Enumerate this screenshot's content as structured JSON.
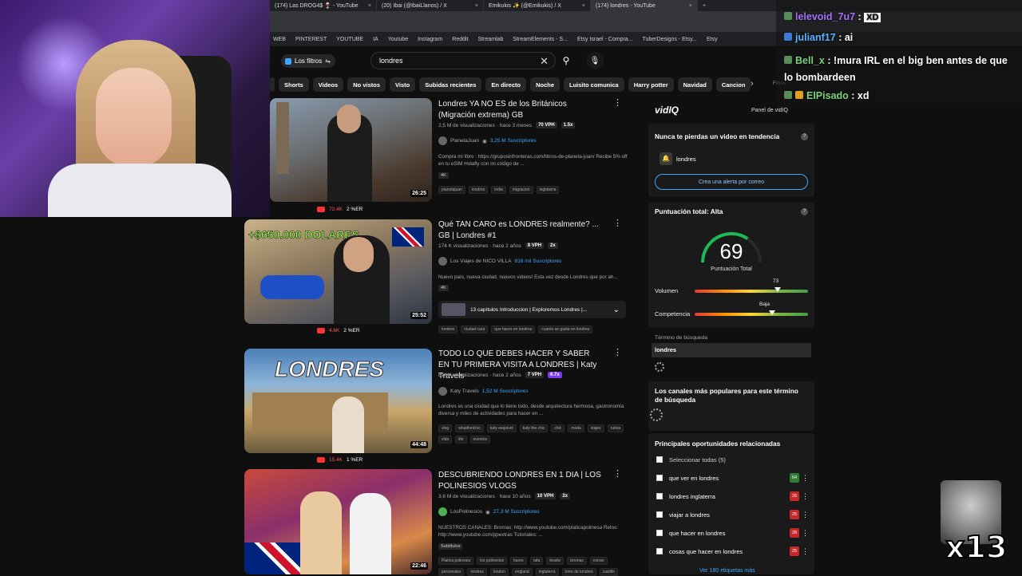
{
  "tabs": [
    {
      "label": "(174) Las DROG4$ 🍷 - YouTube"
    },
    {
      "label": "(20) Ibai (@IbaiLlanos) / X"
    },
    {
      "label": "Emikukis ✨ (@Emikukis) / X"
    },
    {
      "label": "(174) londres - YouTube"
    }
  ],
  "bookmarks": [
    "WEB",
    "PINTEREST",
    "YOUTUBE",
    "IA",
    "Youtube",
    "Instagram",
    "Reddit",
    "Streamlab",
    "StreamElements - S...",
    "Etsy Israel - Compra...",
    "TuberDesigns - Etsy...",
    "Etsy"
  ],
  "youtube": {
    "filters_label": "Los filtros",
    "search_value": "londres",
    "chips": [
      "Shorts",
      "Videos",
      "No vistos",
      "Visto",
      "Subidas recientes",
      "En directo",
      "Noche",
      "Luisito comunica",
      "Harry potter",
      "Navidad",
      "Cancion"
    ],
    "filtros_label": "Filtros"
  },
  "videos": [
    {
      "title": "Londres YA NO ES de los Británicos (Migración extrema) GB",
      "meta": "2,5 M de visualizaciones · hace 3 meses",
      "vph": "70 VPH",
      "mult": "1.5x",
      "channel": "PlanetaJuan",
      "subs": "3,25 M Suscriptores",
      "desc": "Compra mi libro : https://gruposinfronteras.com/libros-de-planeta-juan/ Recibe 5% off en tu eSIM Holafly con mi código de ...",
      "badge": "4K",
      "tags": [
        "planetajuan",
        "londres",
        "india",
        "migracion",
        "inglaterra"
      ],
      "duration": "26:25",
      "views_stat": "72.4K",
      "er": "2 %ER"
    },
    {
      "title": "Qué TAN CARO es LONDRES realmente? ... GB | Londres #1",
      "meta": "174 K visualizaciones · hace 2 años",
      "vph": "8 VPH",
      "mult": "2x",
      "channel": "Los Viajes de NICO VILLA",
      "subs": "816 mil Suscriptores",
      "desc": "Nuevo país, nueva ciudad, nuevos videos! Esta vez desde Londres que por ah...",
      "badge": "4K",
      "chapters": "13 capítulos  Introduccion | Exploremos Londres |...",
      "tags": [
        "londres",
        "ciudad cara",
        "que hacer en londres",
        "cuanto se gasta en londres"
      ],
      "duration": "25:52",
      "views_stat": "4.6K",
      "er": "2 %ER",
      "thumb_text": "+$650.000 DOLARES"
    },
    {
      "title": "TODO LO QUE DEBES HACER Y SABER EN TU PRIMERA VISITA A LONDRES | Katy Travels",
      "meta": "814 K visualizaciones · hace 2 años",
      "vph": "7 VPH",
      "mult": "6.7x",
      "channel": "Katy Travels",
      "subs": "1,52 M Suscriptores",
      "desc": "Londres es una ciudad que lo tiene todo, desde arquitectura hermosa, gastronomía diversa y miles de actividades para hacer en ...",
      "tags": [
        "vlog",
        "whattheichic",
        "katy esquivel",
        "katy the chic",
        "chic",
        "moda",
        "viajes",
        "rutina",
        "vida",
        "life",
        "eventos"
      ],
      "duration": "44:48",
      "views_stat": "15.4K",
      "er": "1 %ER",
      "thumb_text": "LONDRES"
    },
    {
      "title": "DESCUBRIENDO LONDRES EN 1 DIA | LOS POLINESIOS VLOGS",
      "meta": "3,6 M de visualizaciones · hace 10 años",
      "vph": "10 VPH",
      "mult": "2x",
      "channel": "LosPolinesios",
      "subs": "27,3 M Suscriptores",
      "desc": "NUESTROS CANALES: Bromas: http://www.youtube.com/platicapolinesa Retos: http://www.youtube.com/ppextras Tutoriales: ...",
      "badge": "Subtítulos",
      "tags": [
        "Platica polinesia",
        "los polinesios",
        "karen",
        "rafa",
        "lesslie",
        "bromas",
        "extras",
        "personales",
        "londres",
        "london",
        "england",
        "inglaterra",
        "torre de londres",
        "castillo"
      ],
      "duration": "22:46"
    }
  ],
  "vidiq": {
    "logo": "vidIQ",
    "panel_label": "Panel de vidIQ",
    "trend_title": "Nunca te pierdas un video en tendencia",
    "trend_keyword": "londres",
    "alert_button": "Crea una alerta por correo",
    "score_title": "Puntuación total: Alta",
    "score": "69",
    "score_label": "Puntuación Total",
    "volume_label": "Volumen",
    "volume_value": "73",
    "volume_level": 0.73,
    "competition_label": "Competencia",
    "competition_value": "Baja",
    "competition_level": 0.68,
    "search_term_label": "Término de búsqueda",
    "search_term": "londres",
    "channels_title": "Los canales más populares para este término de búsqueda",
    "opps_title": "Principales oportunidades relacionadas",
    "select_all": "Seleccionar todas (5)",
    "opps": [
      {
        "label": "que ver en londres",
        "score": "64",
        "color": "#2e7d32"
      },
      {
        "label": "londres inglaterra",
        "score": "26",
        "color": "#c62828"
      },
      {
        "label": "viajar a londres",
        "score": "25",
        "color": "#c62828"
      },
      {
        "label": "que hacer en londres",
        "score": "28",
        "color": "#c62828"
      },
      {
        "label": "cosas que hacer en londres",
        "score": "25",
        "color": "#c62828"
      }
    ],
    "more_tags": "Ver 180 etiquetas más"
  },
  "chat": [
    {
      "user": "lelevoid_7u7",
      "msg": "XD",
      "color": "#a970ff"
    },
    {
      "user": "julianf17",
      "msg": "ai",
      "color": "#5ab4ff"
    },
    {
      "user": "Bell_x",
      "msg": "!mura IRL en el big ben antes de que lo bombardeen",
      "color": "#7ed37e"
    },
    {
      "user": "ElPisado",
      "msg": "xd",
      "color": "#7ed37e"
    }
  ],
  "overlay_counter": "x13"
}
